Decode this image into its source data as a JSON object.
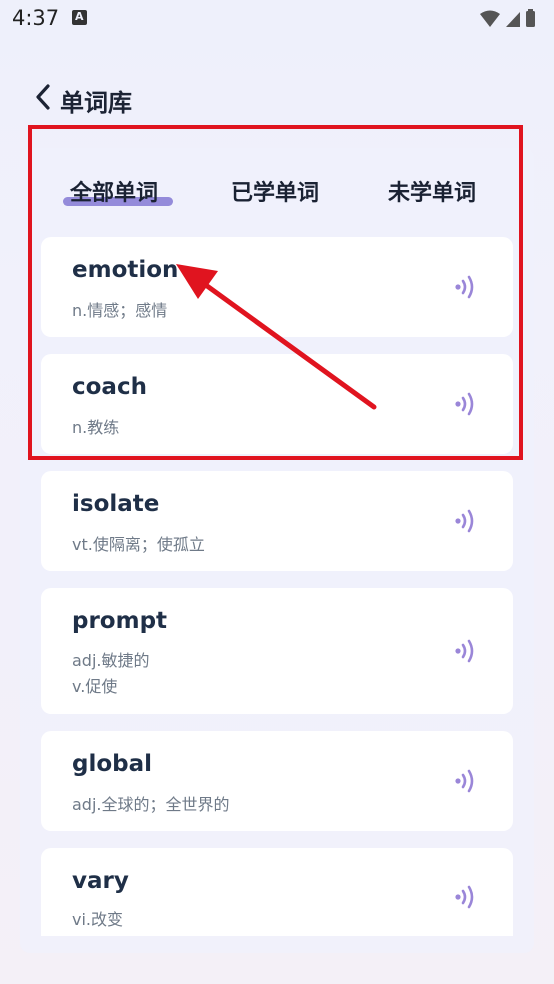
{
  "status_bar": {
    "time": "4:37"
  },
  "header": {
    "title": "单词库"
  },
  "tabs": [
    {
      "label": "全部单词",
      "active": true
    },
    {
      "label": "已学单词",
      "active": false
    },
    {
      "label": "未学单词",
      "active": false
    }
  ],
  "words": [
    {
      "word": "emotion",
      "meaning_lines": [
        "n.情感；感情"
      ]
    },
    {
      "word": "coach",
      "meaning_lines": [
        "n.教练"
      ]
    },
    {
      "word": "isolate",
      "meaning_lines": [
        "vt.使隔离；使孤立"
      ]
    },
    {
      "word": "prompt",
      "meaning_lines": [
        "adj.敏捷的",
        "v.促使"
      ]
    },
    {
      "word": "global",
      "meaning_lines": [
        "adj.全球的；全世界的"
      ]
    },
    {
      "word": "vary",
      "meaning_lines": [
        "vi.改变"
      ]
    }
  ],
  "colors": {
    "accent": "#8a7fd6",
    "speaker": "#9a86d8",
    "annotation": "#e0141f"
  }
}
